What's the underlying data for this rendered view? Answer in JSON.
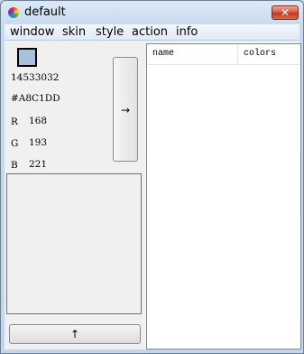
{
  "window": {
    "title": "default",
    "close_glyph": "✕"
  },
  "menu": [
    "window",
    "skin",
    "style",
    "action",
    "info"
  ],
  "color": {
    "swatch_hex": "#A8C1DD",
    "decimal": "14533032",
    "hex": "#A8C1DD",
    "r_label": "R",
    "r_value": "168",
    "g_label": "G",
    "g_value": "193",
    "b_label": "B",
    "b_value": "221"
  },
  "buttons": {
    "arrow_right": "→",
    "arrow_up": "↑"
  },
  "list": {
    "columns": [
      "name",
      "colors"
    ]
  }
}
